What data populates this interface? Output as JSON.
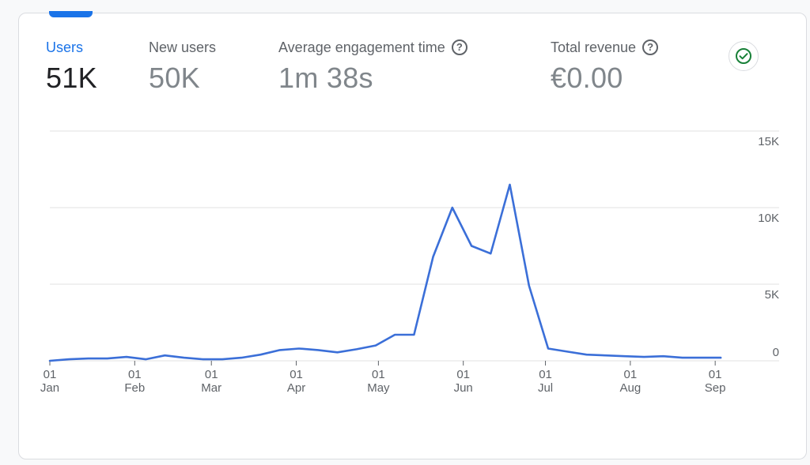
{
  "metrics": [
    {
      "label": "Users",
      "value": "51K",
      "help": false,
      "selected": true
    },
    {
      "label": "New users",
      "value": "50K",
      "help": false,
      "selected": false
    },
    {
      "label": "Average engagement time",
      "value": "1m 38s",
      "help": true,
      "selected": false
    },
    {
      "label": "Total revenue",
      "value": "€0.00",
      "help": true,
      "selected": false
    }
  ],
  "help_icon": {
    "glyph": "?",
    "name": "help-icon"
  },
  "status_icon": {
    "name": "check-circle-icon",
    "color": "#188038"
  },
  "colors": {
    "line": "#3b6fd8",
    "accent": "#1a73e8",
    "grid": "#e0e0e0",
    "axis": "#5f6368"
  },
  "chart_data": {
    "type": "line",
    "series": [
      {
        "x": [
          "2023-01-01",
          "2023-01-08",
          "2023-01-15",
          "2023-01-22",
          "2023-01-29",
          "2023-02-05",
          "2023-02-12",
          "2023-02-19",
          "2023-02-26",
          "2023-03-05",
          "2023-03-12",
          "2023-03-19",
          "2023-03-26",
          "2023-04-02",
          "2023-04-09",
          "2023-04-16",
          "2023-04-23",
          "2023-04-30",
          "2023-05-07",
          "2023-05-14",
          "2023-05-21",
          "2023-05-28",
          "2023-06-04",
          "2023-06-11",
          "2023-06-18",
          "2023-06-25",
          "2023-07-02",
          "2023-07-09",
          "2023-07-16",
          "2023-07-23",
          "2023-07-30",
          "2023-08-06",
          "2023-08-13",
          "2023-08-20",
          "2023-08-27",
          "2023-09-03"
        ],
        "values": [
          0,
          100,
          150,
          150,
          250,
          100,
          350,
          200,
          100,
          100,
          200,
          400,
          700,
          800,
          700,
          550,
          750,
          1000,
          1700,
          1700,
          6800,
          10000,
          7500,
          7000,
          11500,
          4900,
          800,
          600,
          400,
          350,
          300,
          250,
          300,
          200,
          200,
          200
        ]
      }
    ],
    "x_ticks": [
      {
        "date": "2023-01-01",
        "day": "01",
        "month": "Jan"
      },
      {
        "date": "2023-02-01",
        "day": "01",
        "month": "Feb"
      },
      {
        "date": "2023-03-01",
        "day": "01",
        "month": "Mar"
      },
      {
        "date": "2023-04-01",
        "day": "01",
        "month": "Apr"
      },
      {
        "date": "2023-05-01",
        "day": "01",
        "month": "May"
      },
      {
        "date": "2023-06-01",
        "day": "01",
        "month": "Jun"
      },
      {
        "date": "2023-07-01",
        "day": "01",
        "month": "Jul"
      },
      {
        "date": "2023-08-01",
        "day": "01",
        "month": "Aug"
      },
      {
        "date": "2023-09-01",
        "day": "01",
        "month": "Sep"
      }
    ],
    "y_ticks": [
      {
        "value": 0,
        "label": "0"
      },
      {
        "value": 5000,
        "label": "5K"
      },
      {
        "value": 10000,
        "label": "10K"
      },
      {
        "value": 15000,
        "label": "15K"
      }
    ],
    "ylim": [
      0,
      15000
    ],
    "grid": true,
    "y_axis_side": "right"
  }
}
